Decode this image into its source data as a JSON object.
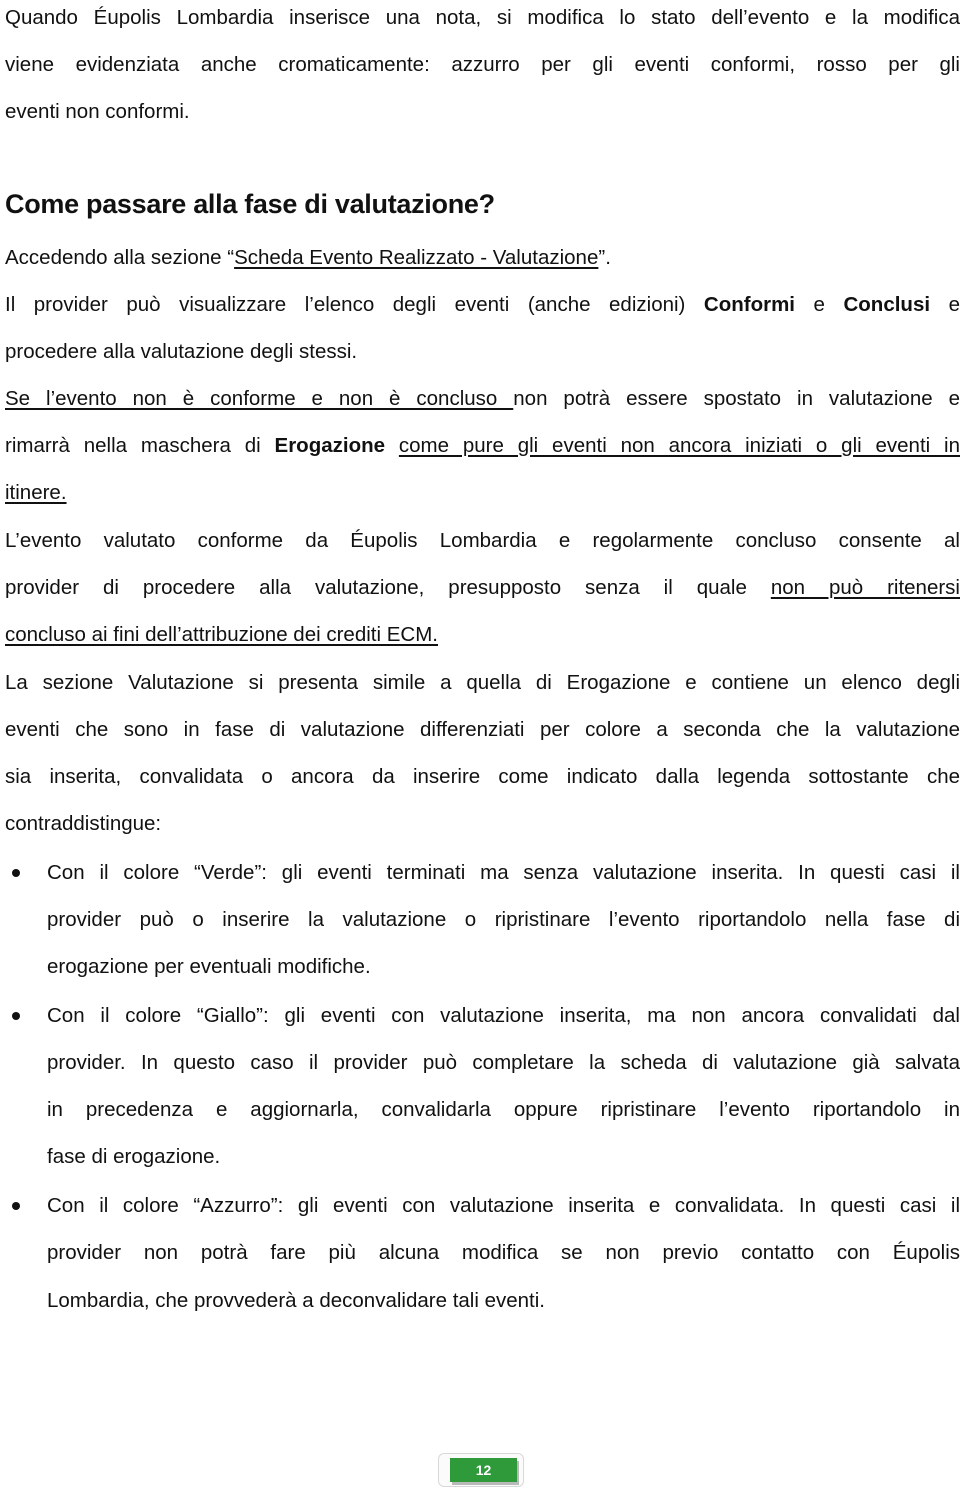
{
  "intro": {
    "lines": [
      "Quando Éupolis Lombardia inserisce una nota, si modifica lo stato dell’evento e la modifica",
      "viene evidenziata anche cromaticamente: azzurro per gli eventi conformi, rosso per gli",
      "eventi non conformi."
    ]
  },
  "heading": "Come passare alla fase di valutazione?",
  "access": {
    "prefix": "Accedendo alla sezione “",
    "link": "Scheda Evento Realizzato - Valutazione",
    "suffix": "”."
  },
  "provider_para": {
    "l1_a": "Il provider può visualizzare l’elenco degli eventi (anche edizioni) ",
    "l1_b1": "Conformi",
    "l1_c": " e ",
    "l1_b2": "Conclusi",
    "l1_d": " e",
    "l2": "procedere alla valutazione degli stessi."
  },
  "nonconforme_para": {
    "l1_u": "Se l’evento non è conforme e non è concluso ",
    "l1_rest": "non potrà essere spostato in valutazione e",
    "l2_a": "rimarrà nella maschera di ",
    "l2_b": "Erogazione",
    "l2_sp": " ",
    "l2_u": "come pure gli eventi non ancora iniziati o gli eventi in",
    "l3_u": "itinere."
  },
  "conforme_para": {
    "l1": "L’evento valutato conforme da Éupolis Lombardia e regolarmente concluso consente al",
    "l2_a": "provider di procedere alla valutazione, presupposto senza il quale ",
    "l2_u": "non può ritenersi",
    "l3_u": "concluso ai fini dell’attribuzione dei crediti ECM."
  },
  "sezione_para": {
    "lines": [
      "La sezione Valutazione si presenta simile a quella di Erogazione e contiene un elenco degli",
      "eventi che sono in fase di valutazione differenziati per colore a seconda che la valutazione",
      "sia inserita, convalidata o ancora da inserire come indicato dalla legenda sottostante che",
      "contraddistingue:"
    ]
  },
  "legend": [
    {
      "color_name": "Verde",
      "lines": [
        "Con il colore “Verde”: gli eventi terminati ma senza valutazione inserita. In questi casi il",
        "provider può o inserire la valutazione o ripristinare l’evento riportandolo nella fase di",
        "erogazione per eventuali modifiche."
      ]
    },
    {
      "color_name": "Giallo",
      "lines": [
        "Con il colore “Giallo”: gli eventi con valutazione inserita, ma non ancora convalidati dal",
        "provider. In questo caso il provider può completare la scheda di valutazione già salvata",
        "in precedenza e aggiornarla, convalidarla oppure ripristinare l’evento riportandolo in",
        "fase di erogazione."
      ]
    },
    {
      "color_name": "Azzurro",
      "lines": [
        "Con il colore “Azzurro”: gli eventi con valutazione inserita e convalidata. In questi casi il",
        "provider non potrà fare più alcuna modifica se non previo contatto con Éupolis",
        "Lombardia, che provvederà a deconvalidare tali eventi."
      ]
    }
  ],
  "footer": {
    "page_number": "12",
    "badge_color": "#2f9a3a"
  }
}
